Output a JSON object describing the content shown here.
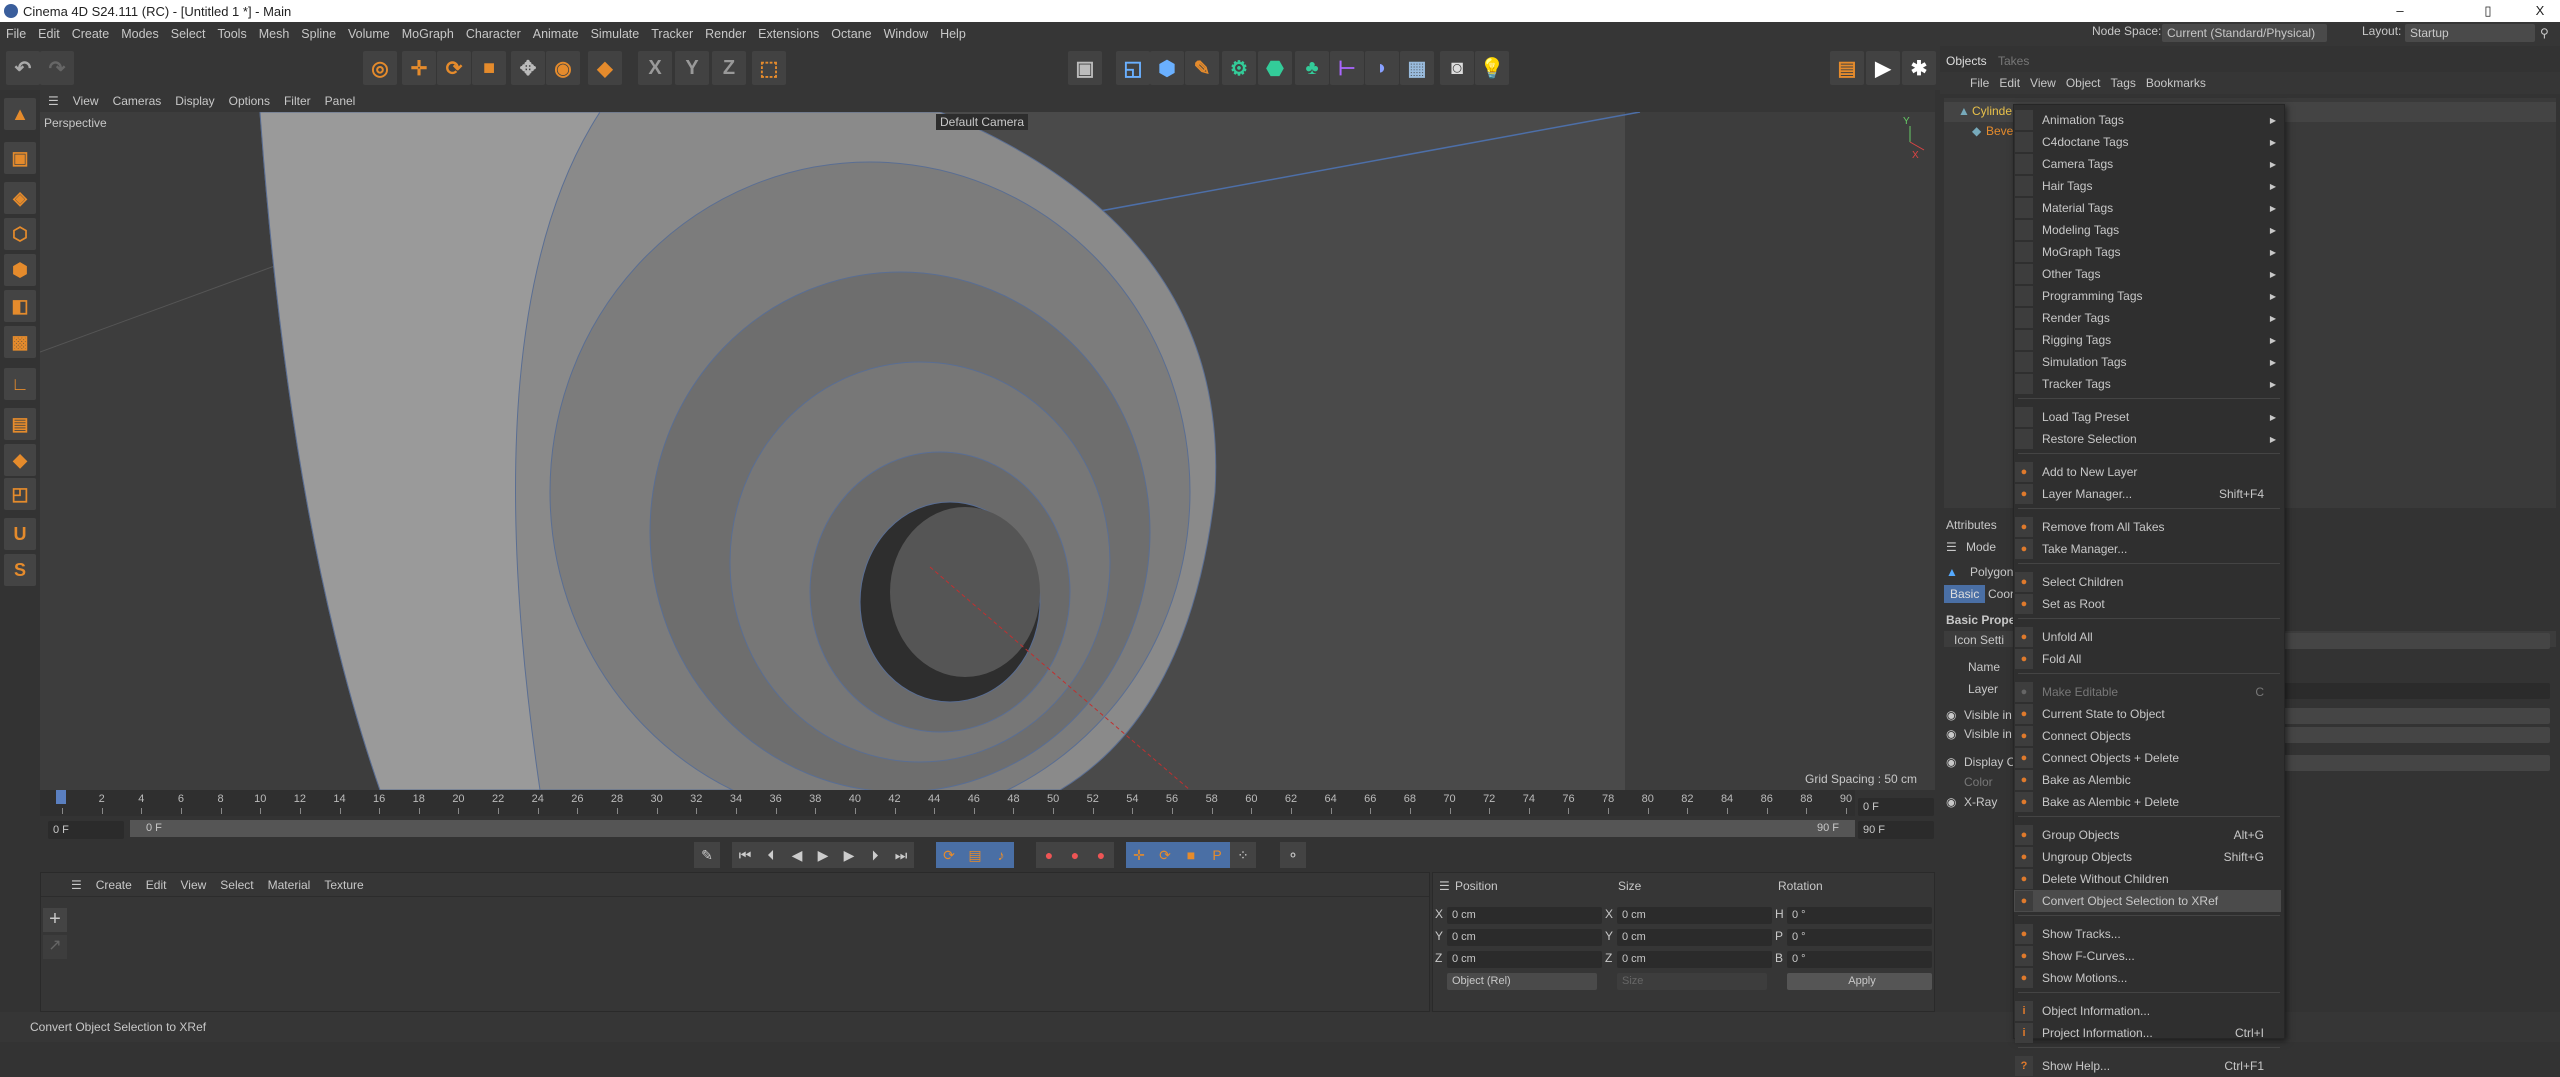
{
  "window": {
    "title": "Cinema 4D S24.111 (RC) - [Untitled 1 *] - Main",
    "minimize": "–",
    "restore": "▯",
    "close": "X"
  },
  "menubar": [
    "File",
    "Edit",
    "Create",
    "Modes",
    "Select",
    "Tools",
    "Mesh",
    "Spline",
    "Volume",
    "MoGraph",
    "Character",
    "Animate",
    "Simulate",
    "Tracker",
    "Render",
    "Extensions",
    "Octane",
    "Window",
    "Help"
  ],
  "node_space": {
    "label": "Node Space:",
    "value": "Current (Standard/Physical)"
  },
  "layout": {
    "label": "Layout:",
    "value": "Startup"
  },
  "toolbar_icons": [
    "undo-icon",
    "redo-icon",
    "live-selection-icon",
    "move-icon",
    "rotate-icon",
    "scale-icon",
    "transform-icon",
    "model-mode-icon",
    "object-icon",
    "x-axis-icon",
    "y-axis-icon",
    "z-axis-icon",
    "coordinate-system-icon",
    "view-panel-icon",
    "spline-pen-icon",
    "cube-icon",
    "pen-icon",
    "subdivision-icon",
    "extrude-icon",
    "cloner-icon",
    "deformer-icon",
    "field-icon",
    "floor-icon",
    "camera-icon",
    "light-icon",
    "render-view-icon",
    "render-icon",
    "render-settings-icon"
  ],
  "toolbar_glyphs": {
    "undo": "↶",
    "redo": "↷",
    "x": "X",
    "y": "Y",
    "z": "Z"
  },
  "viewport": {
    "menu": [
      "View",
      "Cameras",
      "Display",
      "Options",
      "Filter",
      "Panel"
    ],
    "label": "Perspective",
    "camera": "Default Camera",
    "grid_spacing": "Grid Spacing : 50 cm",
    "axis_y": "Y",
    "axis_x": "X"
  },
  "timeline": {
    "ticks": [
      0,
      2,
      4,
      6,
      8,
      10,
      12,
      14,
      16,
      18,
      20,
      22,
      24,
      26,
      28,
      30,
      32,
      34,
      36,
      38,
      40,
      42,
      44,
      46,
      48,
      50,
      52,
      54,
      56,
      58,
      60,
      62,
      64,
      66,
      68,
      70,
      72,
      74,
      76,
      78,
      80,
      82,
      84,
      86,
      88,
      90
    ],
    "current": "0 F",
    "start": "0 F",
    "range_start": "0 F",
    "range_end": "90 F",
    "end": "90 F"
  },
  "material_panel": {
    "menu": [
      "Create",
      "Edit",
      "View",
      "Select",
      "Material",
      "Texture"
    ]
  },
  "coordinates": {
    "headers": [
      "Position",
      "Size",
      "Rotation"
    ],
    "rows": [
      {
        "pl": "X",
        "pv": "0 cm",
        "sl": "X",
        "sv": "0 cm",
        "rl": "H",
        "rv": "0 °"
      },
      {
        "pl": "Y",
        "pv": "0 cm",
        "sl": "Y",
        "sv": "0 cm",
        "rl": "P",
        "rv": "0 °"
      },
      {
        "pl": "Z",
        "pv": "0 cm",
        "sl": "Z",
        "sv": "0 cm",
        "rl": "B",
        "rv": "0 °"
      }
    ],
    "mode": "Object (Rel)",
    "size_mode": "Size",
    "apply": "Apply"
  },
  "status": "Convert Object Selection to XRef",
  "objects_panel": {
    "tabs": [
      "Objects",
      "Takes"
    ],
    "menu": [
      "File",
      "Edit",
      "View",
      "Object",
      "Tags",
      "Bookmarks"
    ],
    "items": [
      "Cylinde",
      "Beve"
    ]
  },
  "attributes_panel": {
    "tab": "Attributes",
    "mode": "Mode",
    "object": "Polygon",
    "subtabs": [
      "Basic",
      "Coor"
    ],
    "section": "Basic Proper",
    "icon_settings": "Icon Setti",
    "fields": [
      "Name",
      "Layer",
      "Visible in",
      "Visible in",
      "Display C",
      "Color",
      "X-Ray"
    ]
  },
  "context_menu": {
    "groups": [
      [
        {
          "label": "Animation Tags",
          "sub": true
        },
        {
          "label": "C4doctane Tags",
          "sub": true
        },
        {
          "label": "Camera Tags",
          "sub": true
        },
        {
          "label": "Hair Tags",
          "sub": true
        },
        {
          "label": "Material Tags",
          "sub": true
        },
        {
          "label": "Modeling Tags",
          "sub": true
        },
        {
          "label": "MoGraph Tags",
          "sub": true
        },
        {
          "label": "Other Tags",
          "sub": true
        },
        {
          "label": "Programming Tags",
          "sub": true
        },
        {
          "label": "Render Tags",
          "sub": true
        },
        {
          "label": "Rigging Tags",
          "sub": true
        },
        {
          "label": "Simulation Tags",
          "sub": true
        },
        {
          "label": "Tracker Tags",
          "sub": true
        }
      ],
      [
        {
          "label": "Load Tag Preset",
          "sub": true
        },
        {
          "label": "Restore Selection",
          "sub": true
        }
      ],
      [
        {
          "label": "Add to New Layer",
          "icon": "layer-add-icon"
        },
        {
          "label": "Layer Manager...",
          "shortcut": "Shift+F4",
          "icon": "layer-manager-icon"
        }
      ],
      [
        {
          "label": "Remove from All Takes",
          "icon": "take-remove-icon"
        },
        {
          "label": "Take Manager...",
          "icon": "take-manager-icon"
        }
      ],
      [
        {
          "label": "Select Children",
          "icon": "select-children-icon"
        },
        {
          "label": "Set as Root",
          "icon": "set-root-icon"
        }
      ],
      [
        {
          "label": "Unfold All",
          "icon": "unfold-icon"
        },
        {
          "label": "Fold All",
          "icon": "fold-icon"
        }
      ],
      [
        {
          "label": "Make Editable",
          "shortcut": "C",
          "disabled": true,
          "icon": "make-editable-icon"
        },
        {
          "label": "Current State to Object",
          "icon": "current-state-icon"
        },
        {
          "label": "Connect Objects",
          "icon": "connect-icon"
        },
        {
          "label": "Connect Objects + Delete",
          "icon": "connect-delete-icon"
        },
        {
          "label": "Bake as Alembic",
          "icon": "alembic-icon"
        },
        {
          "label": "Bake as Alembic + Delete",
          "icon": "alembic-delete-icon"
        }
      ],
      [
        {
          "label": "Group Objects",
          "shortcut": "Alt+G",
          "icon": "group-icon"
        },
        {
          "label": "Ungroup Objects",
          "shortcut": "Shift+G",
          "icon": "ungroup-icon"
        },
        {
          "label": "Delete Without Children",
          "icon": "delete-icon"
        },
        {
          "label": "Convert Object Selection to XRef",
          "highlighted": true,
          "icon": "xref-icon"
        }
      ],
      [
        {
          "label": "Show Tracks...",
          "icon": "tracks-icon"
        },
        {
          "label": "Show F-Curves...",
          "icon": "fcurves-icon"
        },
        {
          "label": "Show Motions...",
          "icon": "motions-icon"
        }
      ],
      [
        {
          "label": "Object Information...",
          "icon": "object-info-icon"
        },
        {
          "label": "Project Information...",
          "shortcut": "Ctrl+I",
          "icon": "project-info-icon"
        }
      ],
      [
        {
          "label": "Show Help...",
          "shortcut": "Ctrl+F1",
          "icon": "help-icon"
        }
      ]
    ]
  },
  "colors": {
    "accent": "#e58b2c",
    "selection": "#4a6fa5",
    "object_name": "#e8c04a"
  }
}
